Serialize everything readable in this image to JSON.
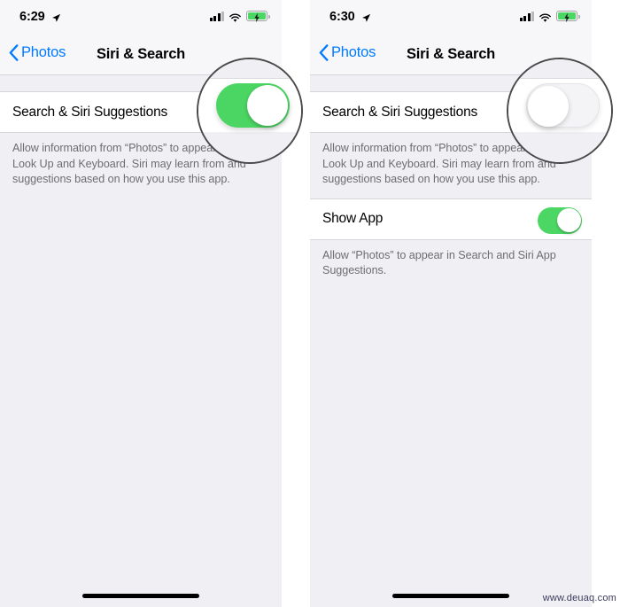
{
  "watermark": "www.deuaq.com",
  "panels": [
    {
      "id": "left",
      "status": {
        "time": "6:29",
        "location_icon": "location-arrow-icon",
        "signal_icon": "cellular-signal-icon",
        "wifi_icon": "wifi-icon",
        "battery_icon": "battery-charging-icon"
      },
      "nav": {
        "back_label": "Photos",
        "back_icon": "chevron-left-icon",
        "title": "Siri & Search"
      },
      "rows": [
        {
          "label": "Search & Siri Suggestions",
          "toggle_state": "on",
          "footer": "Allow information from “Photos” to appear in Search, Look Up and Keyboard. Siri may learn from and suggestions based on how you use this app."
        }
      ],
      "magnifier": {
        "toggle_state": "on"
      }
    },
    {
      "id": "right",
      "status": {
        "time": "6:30",
        "location_icon": "location-arrow-icon",
        "signal_icon": "cellular-signal-icon",
        "wifi_icon": "wifi-icon",
        "battery_icon": "battery-charging-icon"
      },
      "nav": {
        "back_label": "Photos",
        "back_icon": "chevron-left-icon",
        "title": "Siri & Search"
      },
      "rows": [
        {
          "label": "Search & Siri Suggestions",
          "toggle_state": "off",
          "footer": "Allow information from “Photos” to appear in Search, Look Up and Keyboard. Siri may learn from and suggestions based on how you use this app."
        },
        {
          "label": "Show App",
          "toggle_state": "on",
          "footer": "Allow “Photos” to appear in Search and Siri App Suggestions."
        }
      ],
      "magnifier": {
        "toggle_state": "off"
      }
    }
  ],
  "colors": {
    "accent_blue": "#007aff",
    "switch_green": "#4cd764",
    "switch_off": "#e9e9eb",
    "group_bg": "#efeff4",
    "cell_bg": "#ffffff",
    "footer_text": "#6d6d72"
  }
}
